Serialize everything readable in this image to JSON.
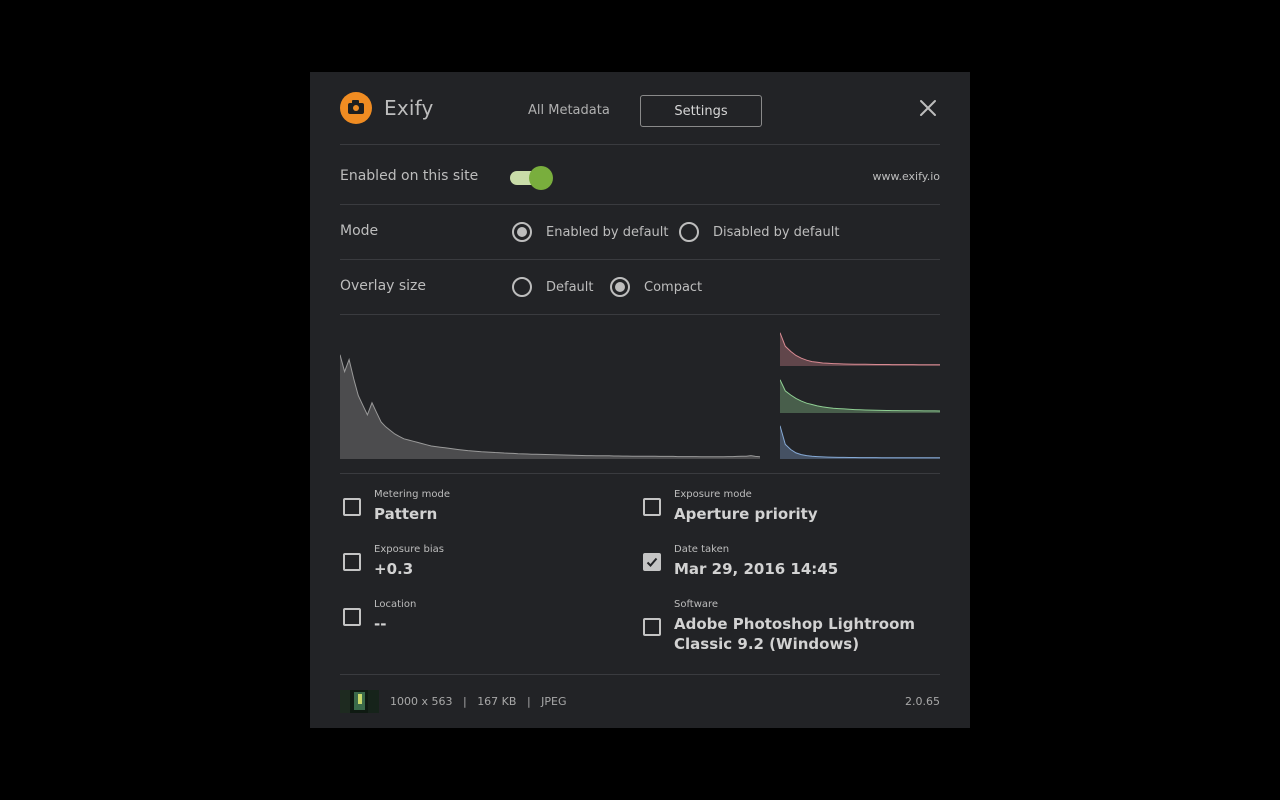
{
  "header": {
    "app_title": "Exify",
    "tabs": [
      {
        "label": "All Metadata"
      },
      {
        "label": "Settings"
      }
    ],
    "logo_color": "#f08c22"
  },
  "settings": {
    "enabled_label": "Enabled on this site",
    "enabled": true,
    "site_link": "www.exify.io",
    "mode": {
      "label": "Mode",
      "options": [
        "Enabled by default",
        "Disabled by default"
      ],
      "selected": "Enabled by default"
    },
    "overlay": {
      "label": "Overlay size",
      "options": [
        "Default",
        "Compact"
      ],
      "selected": "Compact"
    }
  },
  "chart_data": [
    {
      "type": "area",
      "name": "luminance",
      "color": "#9a9a9a",
      "x_range": [
        0,
        255
      ],
      "values": [
        0.86,
        0.72,
        0.82,
        0.66,
        0.52,
        0.44,
        0.36,
        0.46,
        0.38,
        0.3,
        0.26,
        0.23,
        0.2,
        0.18,
        0.16,
        0.15,
        0.14,
        0.13,
        0.12,
        0.11,
        0.1,
        0.095,
        0.09,
        0.085,
        0.08,
        0.075,
        0.07,
        0.066,
        0.062,
        0.058,
        0.055,
        0.052,
        0.05,
        0.048,
        0.046,
        0.044,
        0.042,
        0.04,
        0.038,
        0.036,
        0.034,
        0.033,
        0.032,
        0.031,
        0.03,
        0.029,
        0.028,
        0.027,
        0.026,
        0.025,
        0.024,
        0.023,
        0.022,
        0.021,
        0.02,
        0.02,
        0.019,
        0.019,
        0.018,
        0.018,
        0.017,
        0.017,
        0.016,
        0.016,
        0.015,
        0.015,
        0.015,
        0.014,
        0.014,
        0.014,
        0.013,
        0.013,
        0.013,
        0.013,
        0.012,
        0.012,
        0.012,
        0.012,
        0.012,
        0.011,
        0.011,
        0.011,
        0.011,
        0.011,
        0.011,
        0.012,
        0.012,
        0.013,
        0.014,
        0.015,
        0.02,
        0.013,
        0.01
      ]
    },
    {
      "type": "area",
      "name": "red",
      "color": "#d88a92",
      "x_range": [
        0,
        255
      ],
      "values": [
        0.95,
        0.55,
        0.4,
        0.28,
        0.2,
        0.14,
        0.1,
        0.08,
        0.06,
        0.05,
        0.04,
        0.035,
        0.03,
        0.027,
        0.024,
        0.022,
        0.02,
        0.018,
        0.016,
        0.015,
        0.014,
        0.013,
        0.012,
        0.012,
        0.011,
        0.011,
        0.01,
        0.01,
        0.01,
        0.01,
        0.01
      ]
    },
    {
      "type": "area",
      "name": "green",
      "color": "#8fcf93",
      "x_range": [
        0,
        255
      ],
      "values": [
        0.95,
        0.62,
        0.5,
        0.4,
        0.32,
        0.26,
        0.22,
        0.18,
        0.15,
        0.13,
        0.11,
        0.1,
        0.09,
        0.08,
        0.072,
        0.066,
        0.06,
        0.056,
        0.052,
        0.048,
        0.045,
        0.042,
        0.04,
        0.038,
        0.036,
        0.035,
        0.034,
        0.033,
        0.032,
        0.031,
        0.03
      ]
    },
    {
      "type": "area",
      "name": "blue",
      "color": "#86aad6",
      "x_range": [
        0,
        255
      ],
      "values": [
        0.95,
        0.4,
        0.25,
        0.15,
        0.1,
        0.07,
        0.05,
        0.04,
        0.032,
        0.026,
        0.022,
        0.019,
        0.017,
        0.015,
        0.014,
        0.013,
        0.012,
        0.011,
        0.011,
        0.01,
        0.01,
        0.01,
        0.01,
        0.01,
        0.01,
        0.01,
        0.01,
        0.01,
        0.01,
        0.01,
        0.01
      ]
    }
  ],
  "fields": [
    {
      "label": "Metering mode",
      "value": "Pattern",
      "checked": false
    },
    {
      "label": "Exposure mode",
      "value": "Aperture priority",
      "checked": false
    },
    {
      "label": "Exposure bias",
      "value": "+0.3",
      "checked": false
    },
    {
      "label": "Date taken",
      "value": "Mar 29, 2016 14:45",
      "checked": true
    },
    {
      "label": "Location",
      "value": "--",
      "checked": false
    },
    {
      "label": "Software",
      "value_line1": "Adobe Photoshop Lightroom",
      "value_line2": "Classic 9.2 (Windows)",
      "checked": false
    }
  ],
  "footer": {
    "dimensions": "1000 x 563",
    "file_size": "167 KB",
    "format": "JPEG",
    "version": "2.0.65"
  }
}
